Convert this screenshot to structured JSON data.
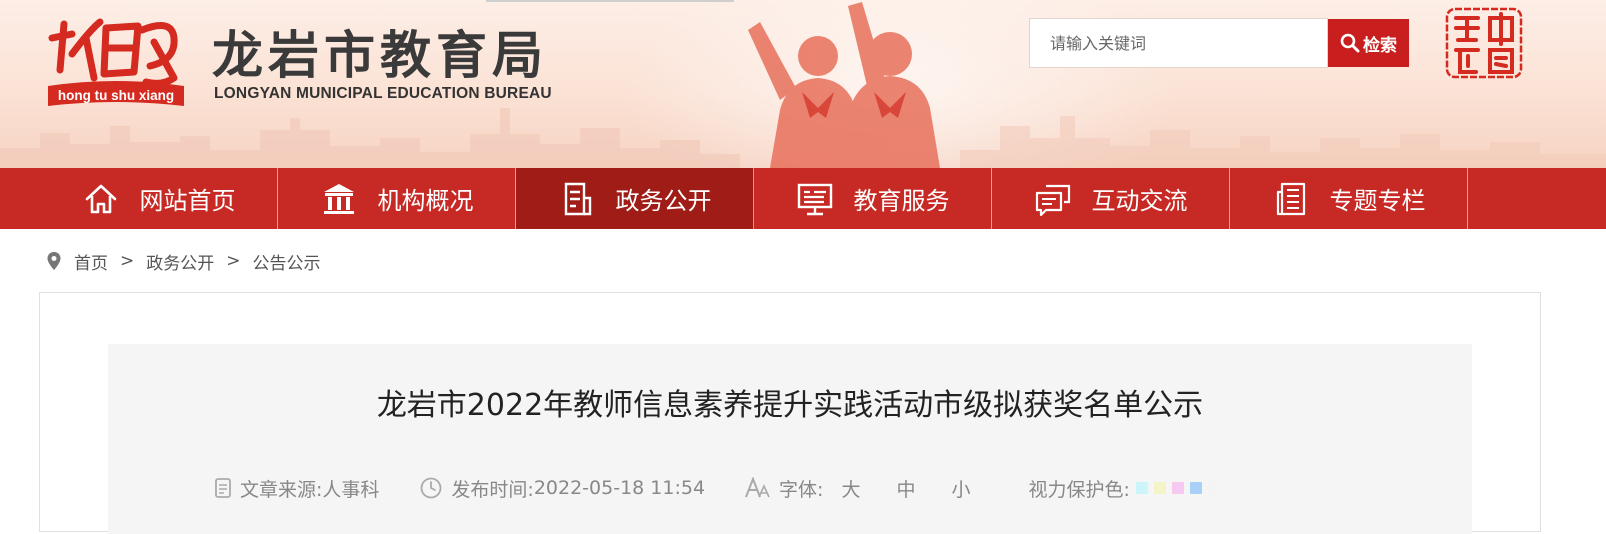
{
  "header": {
    "logo_caption": "hong tu shu xiang",
    "logo_glyph": "紅土書香",
    "site_title_cn": "龙岩市教育局",
    "site_title_en": "LONGYAN MUNICIPAL EDUCATION BUREAU",
    "seal_text": "龍岩中國",
    "search": {
      "placeholder": "请输入关键词",
      "value": "",
      "button_label": "检索"
    }
  },
  "nav": {
    "active": "政务公开",
    "items": [
      {
        "label": "网站首页",
        "icon": "home-icon"
      },
      {
        "label": "机构概况",
        "icon": "institution-icon"
      },
      {
        "label": "政务公开",
        "icon": "document-icon"
      },
      {
        "label": "教育服务",
        "icon": "monitor-icon"
      },
      {
        "label": "互动交流",
        "icon": "chat-icon"
      },
      {
        "label": "专题专栏",
        "icon": "newspaper-icon"
      }
    ]
  },
  "breadcrumb": {
    "icon": "location-pin-icon",
    "items": [
      "首页",
      "政务公开",
      "公告公示"
    ],
    "separator": ">"
  },
  "article": {
    "title": "龙岩市2022年教师信息素养提升实践活动市级拟获奖名单公示",
    "source_label": "文章来源:",
    "source_value": "人事科",
    "date_label": "发布时间:",
    "date_value": "2022-05-18 11:54",
    "font_label": "字体:",
    "font_sizes": [
      "大",
      "中",
      "小"
    ],
    "eye_label": "视力保护色:",
    "eye_colors": [
      "#ccf5fb",
      "#f3f5c8",
      "#f7c9f1",
      "#a9d1f7",
      "#f4f4f4"
    ]
  },
  "colors": {
    "nav_bg": "#c72a24",
    "nav_active": "#a01c17",
    "search_button": "#c81e1e",
    "brand_red": "#d42a20"
  }
}
